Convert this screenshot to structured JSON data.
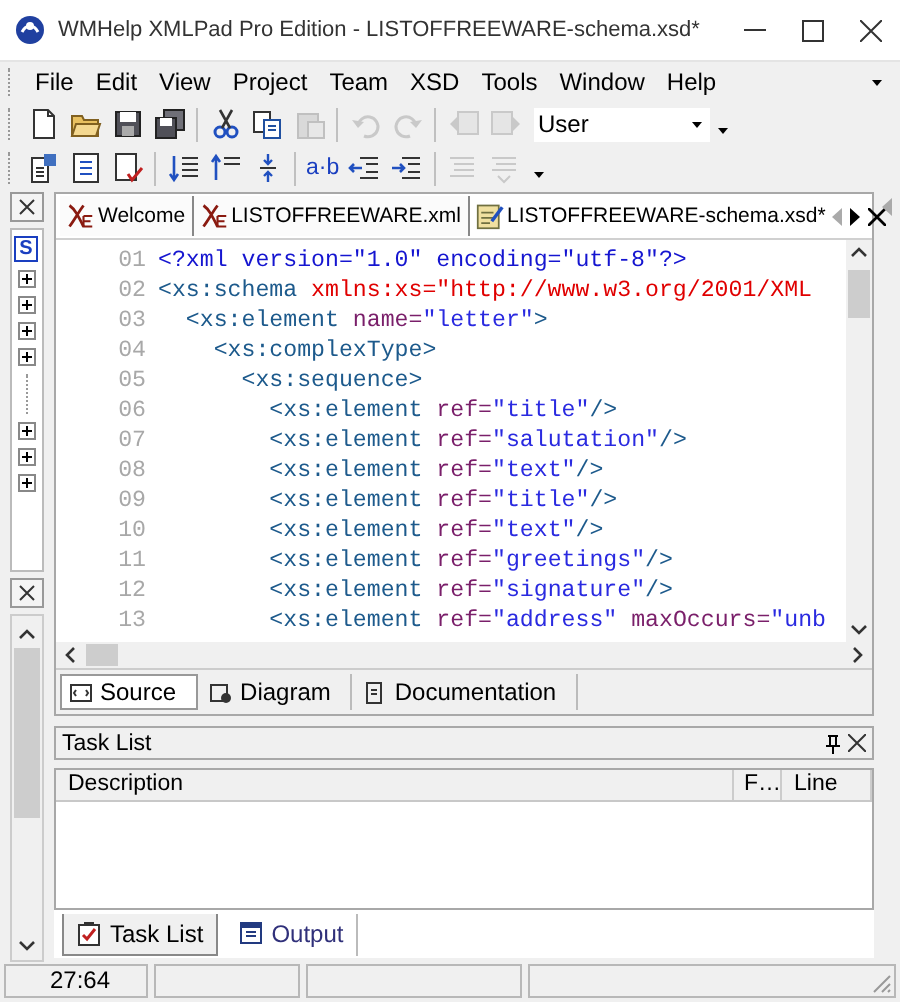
{
  "window": {
    "title": "WMHelp XMLPad Pro Edition - LISTOFFREEWARE-schema.xsd*"
  },
  "menu": [
    "File",
    "Edit",
    "View",
    "Project",
    "Team",
    "XSD",
    "Tools",
    "Window",
    "Help"
  ],
  "toolbars": [
    {
      "buttons": [
        {
          "disabled": false
        },
        {
          "disabled": false
        },
        {
          "disabled": false
        },
        {
          "disabled": false
        },
        {
          "disabled": false
        },
        {
          "disabled": false
        },
        {
          "disabled": true
        },
        {
          "disabled": true
        },
        {
          "disabled": true
        },
        {
          "disabled": true
        },
        {
          "disabled": true
        }
      ],
      "dropdown": {
        "value": "User"
      }
    },
    {
      "buttons": [
        {
          "disabled": false
        },
        {
          "disabled": false
        },
        {
          "disabled": false
        },
        {
          "disabled": false
        },
        {
          "disabled": false
        },
        {
          "disabled": false
        },
        {
          "label": "a·b",
          "disabled": false
        },
        {
          "disabled": false
        },
        {
          "disabled": false
        },
        {
          "disabled": true
        },
        {
          "disabled": true
        }
      ]
    }
  ],
  "left_dock": {
    "root_badge": "S",
    "nodes": [
      {
        "expanded": false
      },
      {
        "expanded": false
      },
      {
        "expanded": false
      },
      {
        "expanded": false
      },
      {
        "expanded": false
      },
      {
        "expanded": false
      },
      {
        "expanded": false
      }
    ]
  },
  "document_tabs": [
    {
      "label": "Welcome",
      "selected": false
    },
    {
      "label": "LISTOFFREEWARE.xml",
      "selected": false
    },
    {
      "label": "LISTOFFREEWARE-schema.xsd*",
      "selected": true
    }
  ],
  "editor": {
    "lines": [
      {
        "number": "01",
        "tokens": [
          {
            "kind": "pi",
            "text": "<?xml version=\"1.0\" encoding=\"utf-8\"?>"
          }
        ]
      },
      {
        "number": "02",
        "tokens": [
          {
            "kind": "tag",
            "text": "<xs:schema "
          },
          {
            "kind": "ns",
            "text": "xmlns:xs=\"http://www.w3.org/2001/XML"
          }
        ]
      },
      {
        "number": "03",
        "tokens": [
          {
            "kind": "tag",
            "text": "  <xs:element "
          },
          {
            "kind": "attr",
            "text": "name="
          },
          {
            "kind": "value",
            "text": "\"letter\""
          },
          {
            "kind": "tag",
            "text": ">"
          }
        ]
      },
      {
        "number": "04",
        "tokens": [
          {
            "kind": "tag",
            "text": "    <xs:complexType>"
          }
        ]
      },
      {
        "number": "05",
        "tokens": [
          {
            "kind": "tag",
            "text": "      <xs:sequence>"
          }
        ]
      },
      {
        "number": "06",
        "tokens": [
          {
            "kind": "tag",
            "text": "        <xs:element "
          },
          {
            "kind": "attr",
            "text": "ref="
          },
          {
            "kind": "value",
            "text": "\"title\""
          },
          {
            "kind": "tag",
            "text": "/>"
          }
        ]
      },
      {
        "number": "07",
        "tokens": [
          {
            "kind": "tag",
            "text": "        <xs:element "
          },
          {
            "kind": "attr",
            "text": "ref="
          },
          {
            "kind": "value",
            "text": "\"salutation\""
          },
          {
            "kind": "tag",
            "text": "/>"
          }
        ]
      },
      {
        "number": "08",
        "tokens": [
          {
            "kind": "tag",
            "text": "        <xs:element "
          },
          {
            "kind": "attr",
            "text": "ref="
          },
          {
            "kind": "value",
            "text": "\"text\""
          },
          {
            "kind": "tag",
            "text": "/>"
          }
        ]
      },
      {
        "number": "09",
        "tokens": [
          {
            "kind": "tag",
            "text": "        <xs:element "
          },
          {
            "kind": "attr",
            "text": "ref="
          },
          {
            "kind": "value",
            "text": "\"title\""
          },
          {
            "kind": "tag",
            "text": "/>"
          }
        ]
      },
      {
        "number": "10",
        "tokens": [
          {
            "kind": "tag",
            "text": "        <xs:element "
          },
          {
            "kind": "attr",
            "text": "ref="
          },
          {
            "kind": "value",
            "text": "\"text\""
          },
          {
            "kind": "tag",
            "text": "/>"
          }
        ]
      },
      {
        "number": "11",
        "tokens": [
          {
            "kind": "tag",
            "text": "        <xs:element "
          },
          {
            "kind": "attr",
            "text": "ref="
          },
          {
            "kind": "value",
            "text": "\"greetings\""
          },
          {
            "kind": "tag",
            "text": "/>"
          }
        ]
      },
      {
        "number": "12",
        "tokens": [
          {
            "kind": "tag",
            "text": "        <xs:element "
          },
          {
            "kind": "attr",
            "text": "ref="
          },
          {
            "kind": "value",
            "text": "\"signature\""
          },
          {
            "kind": "tag",
            "text": "/>"
          }
        ]
      },
      {
        "number": "13",
        "tokens": [
          {
            "kind": "tag",
            "text": "        <xs:element "
          },
          {
            "kind": "attr",
            "text": "ref="
          },
          {
            "kind": "value",
            "text": "\"address\""
          },
          {
            "kind": "attr",
            "text": " maxOccurs="
          },
          {
            "kind": "value",
            "text": "\"unb"
          }
        ]
      }
    ]
  },
  "view_tabs": [
    {
      "label": "Source",
      "selected": true
    },
    {
      "label": "Diagram",
      "selected": false
    },
    {
      "label": "Documentation",
      "selected": false
    }
  ],
  "task_list": {
    "title": "Task List",
    "columns": [
      "Description",
      "F…",
      "Line"
    ]
  },
  "panel_tabs": [
    {
      "label": "Task List",
      "selected": true
    },
    {
      "label": "Output",
      "selected": false
    }
  ],
  "status_bar": [
    "27:64"
  ]
}
